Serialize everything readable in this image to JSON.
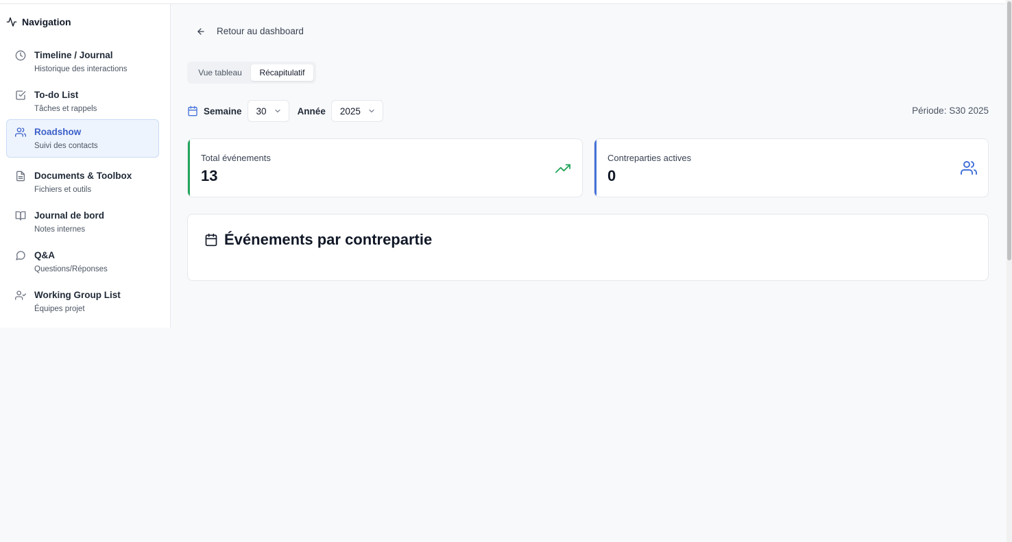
{
  "sidebar": {
    "title": "Navigation",
    "items": [
      {
        "label": "Timeline / Journal",
        "sub": "Historique des interactions",
        "icon": "clock-icon"
      },
      {
        "label": "To-do List",
        "sub": "Tâches et rappels",
        "icon": "checkbox-icon"
      },
      {
        "label": "Roadshow",
        "sub": "Suivi des contacts",
        "icon": "users-icon"
      },
      {
        "label": "Documents & Toolbox",
        "sub": "Fichiers et outils",
        "icon": "document-icon"
      },
      {
        "label": "Journal de bord",
        "sub": "Notes internes",
        "icon": "book-icon"
      },
      {
        "label": "Q&A",
        "sub": "Questions/Réponses",
        "icon": "chat-bubble-icon"
      },
      {
        "label": "Working Group List",
        "sub": "Équipes projet",
        "icon": "user-check-icon"
      }
    ],
    "active_index": 2
  },
  "back": {
    "label": "Retour au dashboard"
  },
  "tabs": [
    {
      "label": "Vue tableau"
    },
    {
      "label": "Récapitulatif"
    }
  ],
  "active_tab": 1,
  "filters": {
    "week_label": "Semaine",
    "week_value": "30",
    "year_label": "Année",
    "year_value": "2025"
  },
  "periode": "Période: S30 2025",
  "stats": [
    {
      "title": "Total événements",
      "value": "13",
      "icon": "trending-up-icon",
      "color": "#22a55b"
    },
    {
      "title": "Contreparties actives",
      "value": "0",
      "icon": "users-icon",
      "color": "#4471d8"
    }
  ],
  "panel": {
    "title": "Événements par contrepartie"
  },
  "colors": {
    "accent": "#3b5fc9",
    "green": "#22a55b",
    "blue": "#4471d8"
  }
}
